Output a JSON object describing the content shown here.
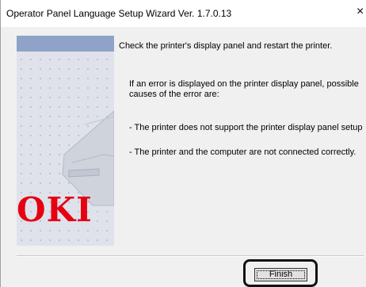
{
  "window": {
    "title": "Operator Panel Language Setup Wizard Ver. 1.7.0.13",
    "close_glyph": "×"
  },
  "sidebar": {
    "logo_text": "OKI",
    "logo_color": "#e60012"
  },
  "content": {
    "headline": "Check the printer's display panel and restart the printer.",
    "intro": "If an error is displayed on the printer display panel, possible causes of the error are:",
    "causes": [
      "- The printer does not support the printer display panel setup",
      "- The printer and the computer are not connected correctly."
    ]
  },
  "footer": {
    "finish_label": "Finish"
  }
}
